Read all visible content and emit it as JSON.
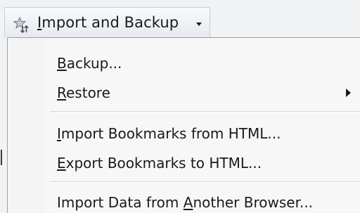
{
  "toolbar": {
    "button": {
      "label_pre": "",
      "label_accel": "I",
      "label_post": "mport and Backup",
      "icon": "star-arrow-icon",
      "dropdown_icon": "chevron-down-icon"
    }
  },
  "menu": {
    "items": [
      {
        "accel": "B",
        "rest": "ackup...",
        "pre": "",
        "submenu": false
      },
      {
        "accel": "R",
        "rest": "estore",
        "pre": "",
        "submenu": true
      },
      {
        "accel": "I",
        "rest": "mport Bookmarks from HTML...",
        "pre": "",
        "submenu": false
      },
      {
        "accel": "E",
        "rest": "xport Bookmarks to HTML...",
        "pre": "",
        "submenu": false
      },
      {
        "pre": "Import Data from ",
        "accel": "A",
        "rest": "nother Browser...",
        "submenu": false
      }
    ]
  }
}
